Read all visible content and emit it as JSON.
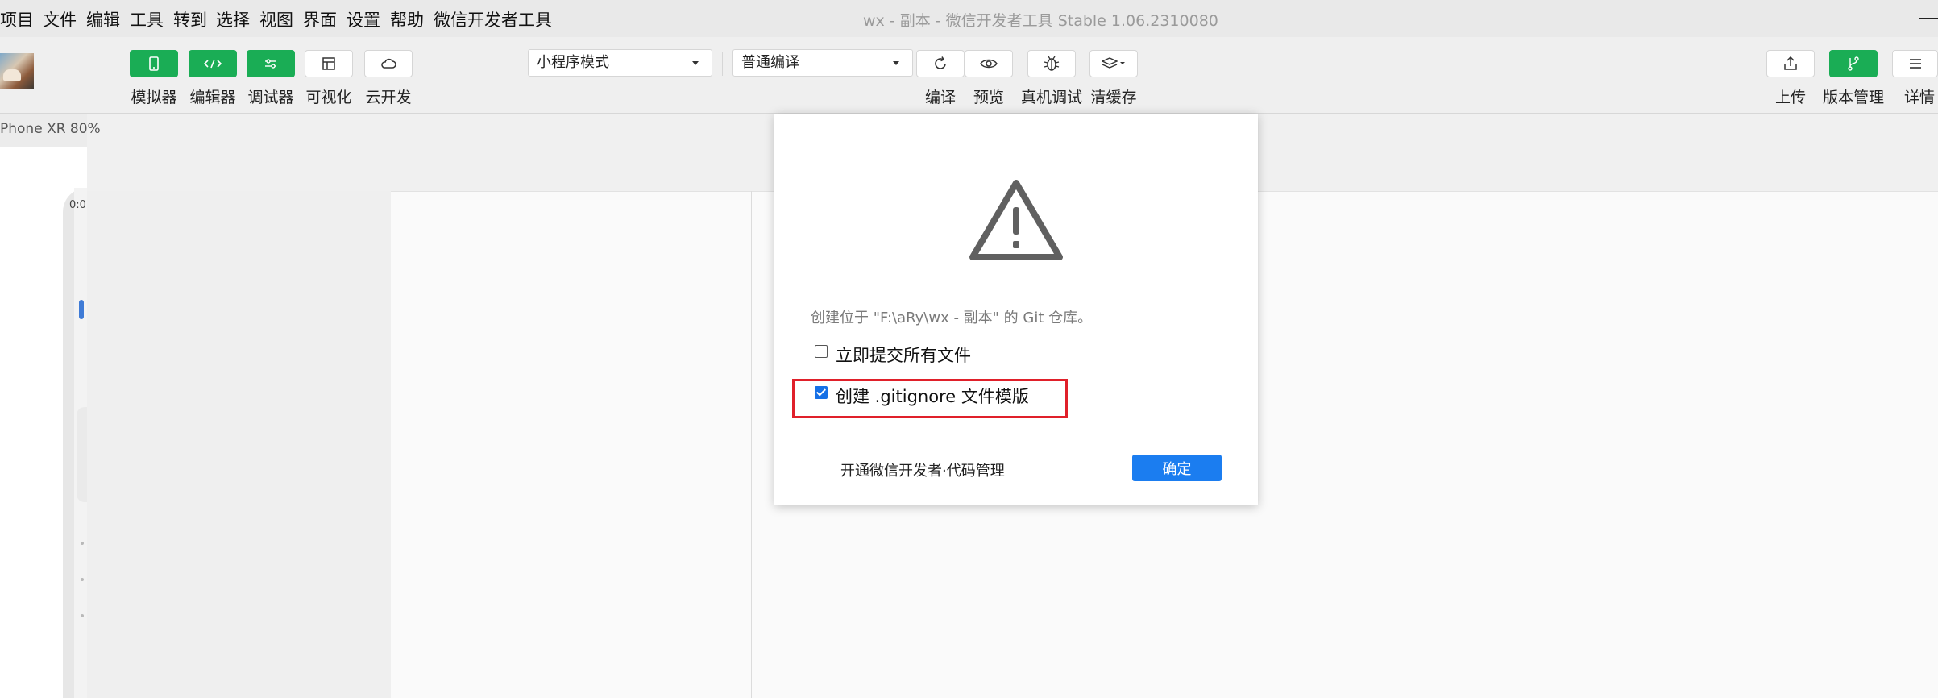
{
  "menu": {
    "items": [
      "项目",
      "文件",
      "编辑",
      "工具",
      "转到",
      "选择",
      "视图",
      "界面",
      "设置",
      "帮助",
      "微信开发者工具"
    ]
  },
  "window": {
    "title": "wx - 副本 - 微信开发者工具 Stable 1.06.2310080"
  },
  "toolbar": {
    "left_buttons": [
      {
        "label": "模拟器",
        "icon": "phone-icon",
        "active": true
      },
      {
        "label": "编辑器",
        "icon": "code-icon",
        "active": true
      },
      {
        "label": "调试器",
        "icon": "sliders-icon",
        "active": true
      },
      {
        "label": "可视化",
        "icon": "layout-icon",
        "active": false
      },
      {
        "label": "云开发",
        "icon": "cloud-icon",
        "active": false
      }
    ],
    "mode_select": "小程序模式",
    "compile_select": "普通编译",
    "action_buttons": [
      {
        "label": "编译",
        "icon": "refresh-icon"
      },
      {
        "label": "预览",
        "icon": "eye-icon"
      },
      {
        "label": "真机调试",
        "icon": "bug-icon"
      },
      {
        "label": "清缓存",
        "icon": "layers-icon"
      }
    ],
    "right_buttons": [
      {
        "label": "上传",
        "icon": "upload-icon",
        "active": false
      },
      {
        "label": "版本管理",
        "icon": "git-branch-icon",
        "active": true
      },
      {
        "label": "详情",
        "icon": "menu-icon",
        "active": false
      }
    ]
  },
  "simulator": {
    "device_label": "Phone XR 80%",
    "time": "0:0"
  },
  "dialog": {
    "icon": "warning-icon",
    "message": "创建位于 \"F:\\aRy\\wx - 副本\" 的 Git 仓库。",
    "checkbox_commit": {
      "label": "立即提交所有文件",
      "checked": false
    },
    "checkbox_gitignore": {
      "label": "创建 .gitignore 文件模版",
      "checked": true
    },
    "link": "开通微信开发者·代码管理",
    "ok_label": "确定"
  },
  "colors": {
    "accent_green": "#1aad55",
    "primary_blue": "#1b7df0",
    "highlight_red": "#e0202a"
  }
}
